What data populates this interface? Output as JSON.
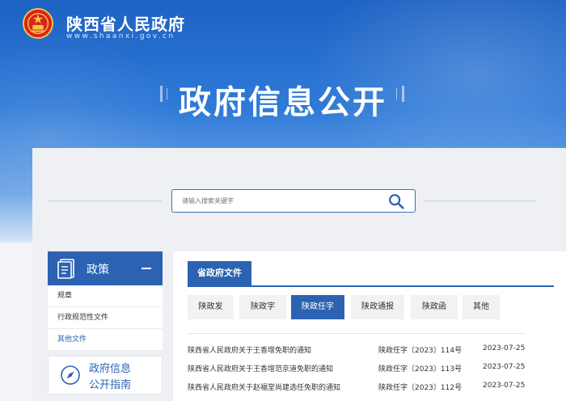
{
  "header": {
    "site_name": "陕西省人民政府",
    "site_domain": "www.shaanxi.gov.cn",
    "page_title": "政府信息公开"
  },
  "search": {
    "placeholder": "请输入搜索关键字"
  },
  "sidebar": {
    "heading": "政策",
    "items": [
      {
        "label": "规章"
      },
      {
        "label": "行政规范性文件"
      },
      {
        "label": "其他文件"
      }
    ],
    "guide_line1": "政府信息",
    "guide_line2": "公开指南"
  },
  "main": {
    "tab_label": "省政府文件",
    "categories": [
      {
        "label": "陕政发"
      },
      {
        "label": "陕政字"
      },
      {
        "label": "陕政任字",
        "active": true
      },
      {
        "label": "陕政通报"
      },
      {
        "label": "陕政函"
      },
      {
        "label": "其他"
      }
    ],
    "rows": [
      {
        "title": "陕西省人民政府关于王香增免职的通知",
        "number": "陕政任字〔2023〕114号",
        "date": "2023-07-25"
      },
      {
        "title": "陕西省人民政府关于王香增范京道免职的通知",
        "number": "陕政任字〔2023〕113号",
        "date": "2023-07-25"
      },
      {
        "title": "陕西省人民政府关于赵福堂尚建选任免职的通知",
        "number": "陕政任字〔2023〕112号",
        "date": "2023-07-25"
      }
    ]
  },
  "colors": {
    "brand_blue": "#2b62b2",
    "hero_top": "#1d62c3"
  }
}
